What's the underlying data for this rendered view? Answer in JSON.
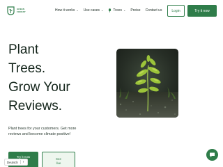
{
  "brand": {
    "logo_line1": "GREEN",
    "logo_line2": "FOREST"
  },
  "nav": {
    "items": [
      {
        "label": "How it works",
        "has_dropdown": true
      },
      {
        "label": "Use cases",
        "has_dropdown": true
      },
      {
        "label": "Trees",
        "has_dropdown": true,
        "icon": "tree-icon"
      },
      {
        "label": "Preise",
        "has_dropdown": false
      },
      {
        "label": "Contact us",
        "has_dropdown": false
      }
    ],
    "login_label": "Login",
    "try_label": "Try it now"
  },
  "hero": {
    "title_lines": [
      "Plant",
      "Trees.",
      "Grow Your",
      "Reviews."
    ],
    "subtitle": "Plant trees for your customers. Get more reviews and become climate positive!",
    "primary_cta": "Try it now",
    "secondary_cta_line1": "See",
    "secondary_cta_line2": "live"
  },
  "language": {
    "label": "Deutsch"
  },
  "colors": {
    "brand_green": "#2f7d4a",
    "light_green": "#eef6ee",
    "text_dark": "#13241a"
  }
}
